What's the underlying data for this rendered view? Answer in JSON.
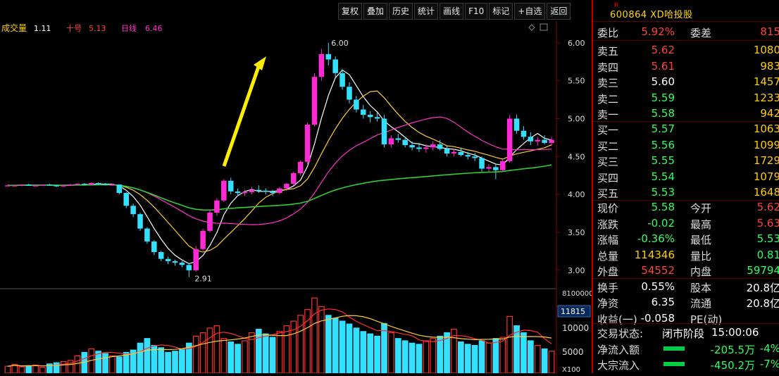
{
  "toolbar": [
    "复权",
    "叠加",
    "历史",
    "统计",
    "画线",
    "F10",
    "标记",
    "+自选",
    "返回"
  ],
  "legend": {
    "title": "成交量",
    "v1": "1.11",
    "ma": "十号",
    "v2": "5.13",
    "ma2": "日线",
    "v3": "6.46"
  },
  "price_axis": [
    "6.00",
    "5.50",
    "5.00",
    "4.50",
    "4.00",
    "3.50",
    "3.00"
  ],
  "high_label": "6.00",
  "low_label": "2.91",
  "vol_axis": [
    "10000",
    "5000"
  ],
  "vol_axis_top": "8100000",
  "vol_axis_bottom": "X100",
  "vol_current": "11815",
  "header": {
    "rtag": "R",
    "code": "600864 XD哈投股"
  },
  "ratio": {
    "label": "委比",
    "value": "5.92%",
    "label2": "委差",
    "value2": "815"
  },
  "asks": [
    {
      "label": "卖五",
      "price": "5.62",
      "vol": "1080"
    },
    {
      "label": "卖四",
      "price": "5.61",
      "vol": "983"
    },
    {
      "label": "卖三",
      "price": "5.60",
      "vol": "1457"
    },
    {
      "label": "卖二",
      "price": "5.59",
      "vol": "1233"
    },
    {
      "label": "卖一",
      "price": "5.58",
      "vol": "942"
    }
  ],
  "bids": [
    {
      "label": "买一",
      "price": "5.57",
      "vol": "1063"
    },
    {
      "label": "买二",
      "price": "5.56",
      "vol": "1099"
    },
    {
      "label": "买三",
      "price": "5.55",
      "vol": "1729"
    },
    {
      "label": "买四",
      "price": "5.54",
      "vol": "1079"
    },
    {
      "label": "买五",
      "price": "5.53",
      "vol": "1648"
    }
  ],
  "quote": [
    {
      "l1": "现价",
      "v1": "5.58",
      "l2": "今开",
      "v2": "5.62",
      "c1": "green",
      "c2": "red"
    },
    {
      "l1": "涨跌",
      "v1": "-0.02",
      "l2": "最高",
      "v2": "5.63",
      "c1": "green",
      "c2": "red"
    },
    {
      "l1": "涨幅",
      "v1": "-0.36%",
      "l2": "最低",
      "v2": "5.53",
      "c1": "green",
      "c2": "green"
    },
    {
      "l1": "总量",
      "v1": "114346",
      "l2": "量比",
      "v2": "0.81",
      "c1": "gold",
      "c2": "green"
    },
    {
      "l1": "外盘",
      "v1": "54552",
      "l2": "内盘",
      "v2": "59794",
      "c1": "red",
      "c2": "green"
    },
    {
      "l1": "换手",
      "v1": "0.55%",
      "l2": "股本",
      "v2": "20.8亿",
      "c1": "white",
      "c2": "white"
    },
    {
      "l1": "净资",
      "v1": "6.35",
      "l2": "流通",
      "v2": "20.8亿",
      "c1": "white",
      "c2": "white"
    },
    {
      "l1": "收益(一)",
      "v1": "-0.058",
      "l2": "PE(动)",
      "v2": "",
      "c1": "white",
      "c2": "white"
    }
  ],
  "trade_status": {
    "label": "交易状态:",
    "status": "闭市阶段",
    "time": "15:00:06"
  },
  "flows": [
    {
      "label": "净流入额",
      "value": "-205.5万",
      "pct": "-4%"
    },
    {
      "label": "大宗流入",
      "value": "-450.2万",
      "pct": "-7%"
    }
  ],
  "chart_data": {
    "type": "candlestick",
    "ylim": [
      2.85,
      6.1
    ],
    "candles": [
      [
        4.12,
        4.13,
        4.11,
        4.12
      ],
      [
        4.12,
        4.13,
        4.11,
        4.12
      ],
      [
        4.12,
        4.13,
        4.11,
        4.13
      ],
      [
        4.13,
        4.14,
        4.12,
        4.12
      ],
      [
        4.12,
        4.13,
        4.11,
        4.12
      ],
      [
        4.12,
        4.13,
        4.11,
        4.13
      ],
      [
        4.13,
        4.14,
        4.12,
        4.12
      ],
      [
        4.12,
        4.13,
        4.1,
        4.11
      ],
      [
        4.11,
        4.13,
        4.1,
        4.12
      ],
      [
        4.12,
        4.14,
        4.11,
        4.13
      ],
      [
        4.13,
        4.15,
        4.12,
        4.14
      ],
      [
        4.14,
        4.15,
        4.12,
        4.13
      ],
      [
        4.13,
        4.16,
        4.12,
        4.15
      ],
      [
        4.15,
        4.16,
        4.13,
        4.14
      ],
      [
        4.14,
        4.15,
        4.12,
        4.13
      ],
      [
        4.13,
        4.14,
        4.12,
        4.13
      ],
      [
        4.13,
        4.12,
        4.0,
        4.02
      ],
      [
        4.02,
        4.03,
        3.82,
        3.85
      ],
      [
        3.85,
        3.88,
        3.7,
        3.74
      ],
      [
        3.74,
        3.76,
        3.52,
        3.55
      ],
      [
        3.55,
        3.57,
        3.35,
        3.38
      ],
      [
        3.38,
        3.4,
        3.2,
        3.24
      ],
      [
        3.24,
        3.26,
        3.12,
        3.15
      ],
      [
        3.15,
        3.18,
        3.08,
        3.12
      ],
      [
        3.12,
        3.14,
        3.06,
        3.1
      ],
      [
        3.1,
        3.12,
        3.04,
        3.07
      ],
      [
        3.07,
        3.09,
        2.91,
        3.0
      ],
      [
        3.0,
        3.32,
        2.98,
        3.28
      ],
      [
        3.28,
        3.55,
        3.26,
        3.52
      ],
      [
        3.52,
        3.8,
        3.5,
        3.76
      ],
      [
        3.76,
        3.95,
        3.72,
        3.92
      ],
      [
        3.92,
        4.2,
        3.9,
        4.18
      ],
      [
        4.18,
        4.22,
        4.0,
        4.04
      ],
      [
        4.04,
        4.08,
        3.98,
        4.02
      ],
      [
        4.02,
        4.06,
        3.98,
        4.03
      ],
      [
        4.03,
        4.1,
        4.0,
        4.06
      ],
      [
        4.06,
        4.12,
        4.02,
        4.05
      ],
      [
        4.05,
        4.08,
        4.0,
        4.04
      ],
      [
        4.04,
        4.06,
        3.98,
        4.02
      ],
      [
        4.02,
        4.1,
        4.0,
        4.08
      ],
      [
        4.08,
        4.15,
        4.05,
        4.14
      ],
      [
        4.14,
        4.3,
        4.12,
        4.28
      ],
      [
        4.28,
        4.45,
        4.25,
        4.43
      ],
      [
        4.43,
        4.95,
        4.4,
        4.92
      ],
      [
        4.92,
        5.6,
        4.9,
        5.55
      ],
      [
        5.55,
        5.92,
        5.5,
        5.85
      ],
      [
        5.85,
        6.0,
        5.7,
        5.78
      ],
      [
        5.78,
        5.82,
        5.55,
        5.6
      ],
      [
        5.6,
        5.65,
        5.38,
        5.42
      ],
      [
        5.42,
        5.48,
        5.2,
        5.25
      ],
      [
        5.25,
        5.3,
        5.08,
        5.12
      ],
      [
        5.12,
        5.18,
        5.0,
        5.05
      ],
      [
        5.05,
        5.1,
        4.95,
        5.02
      ],
      [
        5.02,
        5.08,
        4.96,
        5.0
      ],
      [
        5.0,
        5.05,
        4.62,
        4.66
      ],
      [
        4.66,
        4.78,
        4.62,
        4.74
      ],
      [
        4.74,
        4.8,
        4.68,
        4.72
      ],
      [
        4.72,
        4.76,
        4.62,
        4.65
      ],
      [
        4.65,
        4.7,
        4.58,
        4.62
      ],
      [
        4.62,
        4.68,
        4.56,
        4.6
      ],
      [
        4.6,
        4.66,
        4.55,
        4.62
      ],
      [
        4.62,
        4.7,
        4.58,
        4.66
      ],
      [
        4.66,
        4.72,
        4.58,
        4.6
      ],
      [
        4.6,
        4.64,
        4.5,
        4.54
      ],
      [
        4.54,
        4.6,
        4.5,
        4.56
      ],
      [
        4.56,
        4.62,
        4.5,
        4.52
      ],
      [
        4.52,
        4.56,
        4.46,
        4.5
      ],
      [
        4.5,
        4.55,
        4.44,
        4.48
      ],
      [
        4.48,
        4.5,
        4.3,
        4.34
      ],
      [
        4.34,
        4.4,
        4.3,
        4.36
      ],
      [
        4.36,
        4.4,
        4.2,
        4.32
      ],
      [
        4.32,
        4.46,
        4.3,
        4.44
      ],
      [
        4.44,
        5.05,
        4.42,
        5.0
      ],
      [
        5.0,
        5.05,
        4.8,
        4.84
      ],
      [
        4.84,
        4.9,
        4.72,
        4.76
      ],
      [
        4.76,
        4.82,
        4.65,
        4.7
      ],
      [
        4.7,
        4.76,
        4.64,
        4.72
      ],
      [
        4.72,
        4.78,
        4.66,
        4.68
      ],
      [
        4.68,
        4.76,
        4.64,
        4.72
      ]
    ],
    "ma_periods": [
      5,
      10,
      20,
      60
    ],
    "ma_colors": [
      "#ffffff",
      "#ffcc33",
      "#ff33cc",
      "#33cc33"
    ],
    "volume": [
      120,
      150,
      110,
      130,
      140,
      100,
      160,
      180,
      200,
      220,
      300,
      360,
      420,
      380,
      340,
      300,
      280,
      360,
      400,
      520,
      600,
      480,
      440,
      360,
      380,
      420,
      520,
      640,
      700,
      780,
      820,
      600,
      540,
      500,
      560,
      700,
      760,
      680,
      620,
      720,
      820,
      900,
      1000,
      1100,
      1300,
      1150,
      1000,
      950,
      900,
      850,
      780,
      720,
      680,
      640,
      860,
      700,
      600,
      560,
      520,
      500,
      560,
      600,
      640,
      700,
      760,
      540,
      500,
      480,
      560,
      520,
      600,
      620,
      980,
      820,
      700,
      560,
      480,
      420,
      380
    ]
  }
}
